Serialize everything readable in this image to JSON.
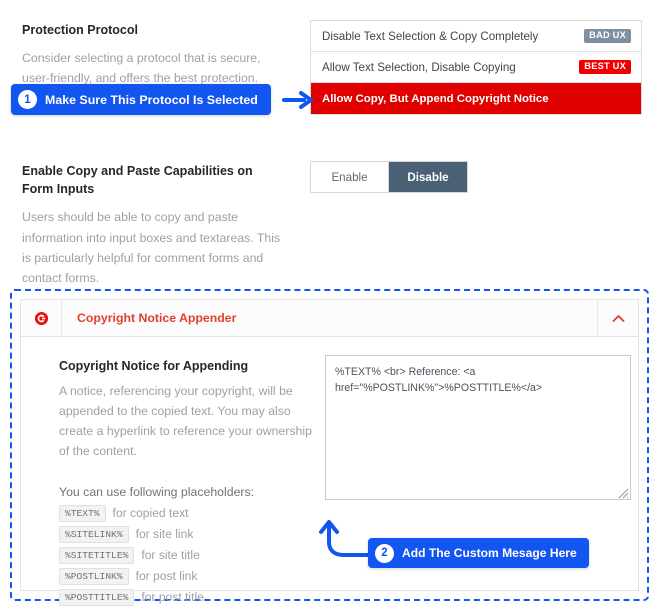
{
  "protection_protocol": {
    "label": "Protection Protocol",
    "description": "Consider selecting a protocol that is secure, user-friendly, and offers the best protection.",
    "options": [
      {
        "text": "Disable Text Selection & Copy Completely",
        "badge": "BAD UX",
        "badge_kind": "bad",
        "selected": false
      },
      {
        "text": "Allow Text Selection, Disable Copying",
        "badge": "BEST UX",
        "badge_kind": "best",
        "selected": false
      },
      {
        "text": "Allow Copy, But Append Copyright Notice",
        "badge": "",
        "badge_kind": "",
        "selected": true
      }
    ]
  },
  "form_inputs": {
    "label": "Enable Copy and Paste Capabilities on Form Inputs",
    "description": "Users should be able to copy and paste information into input boxes and textareas. This is particularly helpful for comment forms and contact forms.",
    "toggle": {
      "enable_label": "Enable",
      "disable_label": "Disable",
      "selected": "Disable"
    }
  },
  "appender_panel": {
    "icon": "copyright-icon",
    "title": "Copyright Notice Appender",
    "collapse_icon": "chevron-up-icon",
    "notice": {
      "title": "Copyright Notice for Appending",
      "description": "A notice, referencing your copyright, will be appended to the copied text. You may also create a hyperlink to reference your ownership of the content.",
      "placeholders_heading": "You can use following placeholders:",
      "placeholders": [
        {
          "code": "%TEXT%",
          "label": "for copied text"
        },
        {
          "code": "%SITELINK%",
          "label": "for site link"
        },
        {
          "code": "%SITETITLE%",
          "label": "for site title"
        },
        {
          "code": "%POSTLINK%",
          "label": "for post link"
        },
        {
          "code": "%POSTTITLE%",
          "label": "for post title"
        }
      ],
      "textarea_value": "%TEXT% <br> Reference: <a href=\"%POSTLINK%\">%POSTTITLE%</a>",
      "textarea_placeholder": ""
    }
  },
  "callouts": [
    {
      "number": "1",
      "text": "Make Sure This Protocol Is Selected"
    },
    {
      "number": "2",
      "text": "Add The Custom Mesage Here"
    }
  ],
  "colors": {
    "accent_blue": "#1355f0",
    "selected_red": "#e00000",
    "best_ux_red": "#ef0000",
    "bad_ux_gray": "#7d8fa0",
    "toggle_active": "#4a6175",
    "panel_title_red": "#e2402e"
  }
}
